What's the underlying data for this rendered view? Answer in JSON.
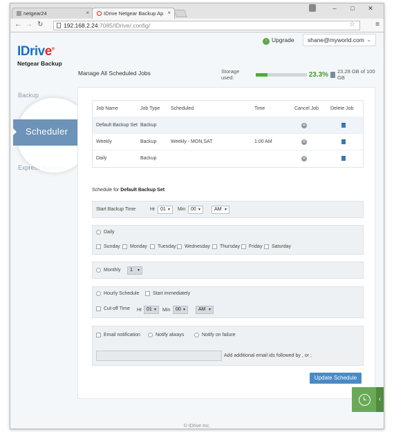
{
  "browser": {
    "tabs": [
      {
        "label": "netgear24"
      },
      {
        "label": "IDrive Netgear Backup Ap"
      }
    ],
    "url_host": "192.168.2.24",
    "url_path": ":7085/IDrive/.config/"
  },
  "header": {
    "upgrade_label": "Upgrade",
    "user_email": "shane@myworld.com",
    "logo_text_main": "IDriv",
    "logo_text_e": "e",
    "logo_reg": "®",
    "logo_sub": "Netgear Backup"
  },
  "page_title": "Manage All Scheduled Jobs",
  "storage": {
    "label": "Storage used:",
    "percent": "23.3%",
    "percent_value": 23.3,
    "detail": "23.28 GB of 100 GB"
  },
  "sidebar": {
    "backup": "Backup",
    "scheduler": "Scheduler",
    "express_backup": "Express Backup"
  },
  "jobs_table": {
    "headers": [
      "Job Name",
      "Job Type",
      "Scheduled",
      "Time",
      "Cancel Job",
      "Delete Job"
    ],
    "rows": [
      {
        "name": "Default Backup Set",
        "type": "Backup",
        "scheduled": "",
        "time": ""
      },
      {
        "name": "Weekly",
        "type": "Backup",
        "scheduled": "Weekly - MON,SAT",
        "time": "1:00 AM"
      },
      {
        "name": "Daily",
        "type": "Backup",
        "scheduled": "",
        "time": ""
      }
    ]
  },
  "schedule_form": {
    "schedule_for_label": "Schedule for",
    "schedule_for_name": "Default Backup Set",
    "start_time_label": "Start Backup Time",
    "hr_label": "Hr",
    "min_label": "Min",
    "hr_value": "01",
    "min_value": "00",
    "ampm_value": "AM",
    "daily_label": "Daily",
    "days": [
      "Sunday",
      "Monday",
      "Tuesday",
      "Wednesday",
      "Thursday",
      "Friday",
      "Saturday"
    ],
    "monthly_label": "Monthly",
    "monthly_value": "1",
    "hourly_label": "Hourly Schedule",
    "start_immediately_label": "Start immediately",
    "cutoff_label": "Cut-off Time",
    "cutoff_hr_value": "01",
    "cutoff_min_value": "00",
    "cutoff_ampm_value": "AM",
    "email_notification_label": "Email notification",
    "notify_always_label": "Notify always",
    "notify_failure_label": "Notify on failure",
    "email_hint": "Add additional email ids followed by , or ;",
    "update_button": "Update Schedule"
  },
  "footer": "© IDrive Inc.",
  "colors": {
    "brand_blue": "#1c6fc5",
    "brand_red": "#e8252b",
    "sidebar_active": "#6d93b8",
    "button_blue": "#4a8ac6",
    "storage_green": "#4caf2f"
  }
}
